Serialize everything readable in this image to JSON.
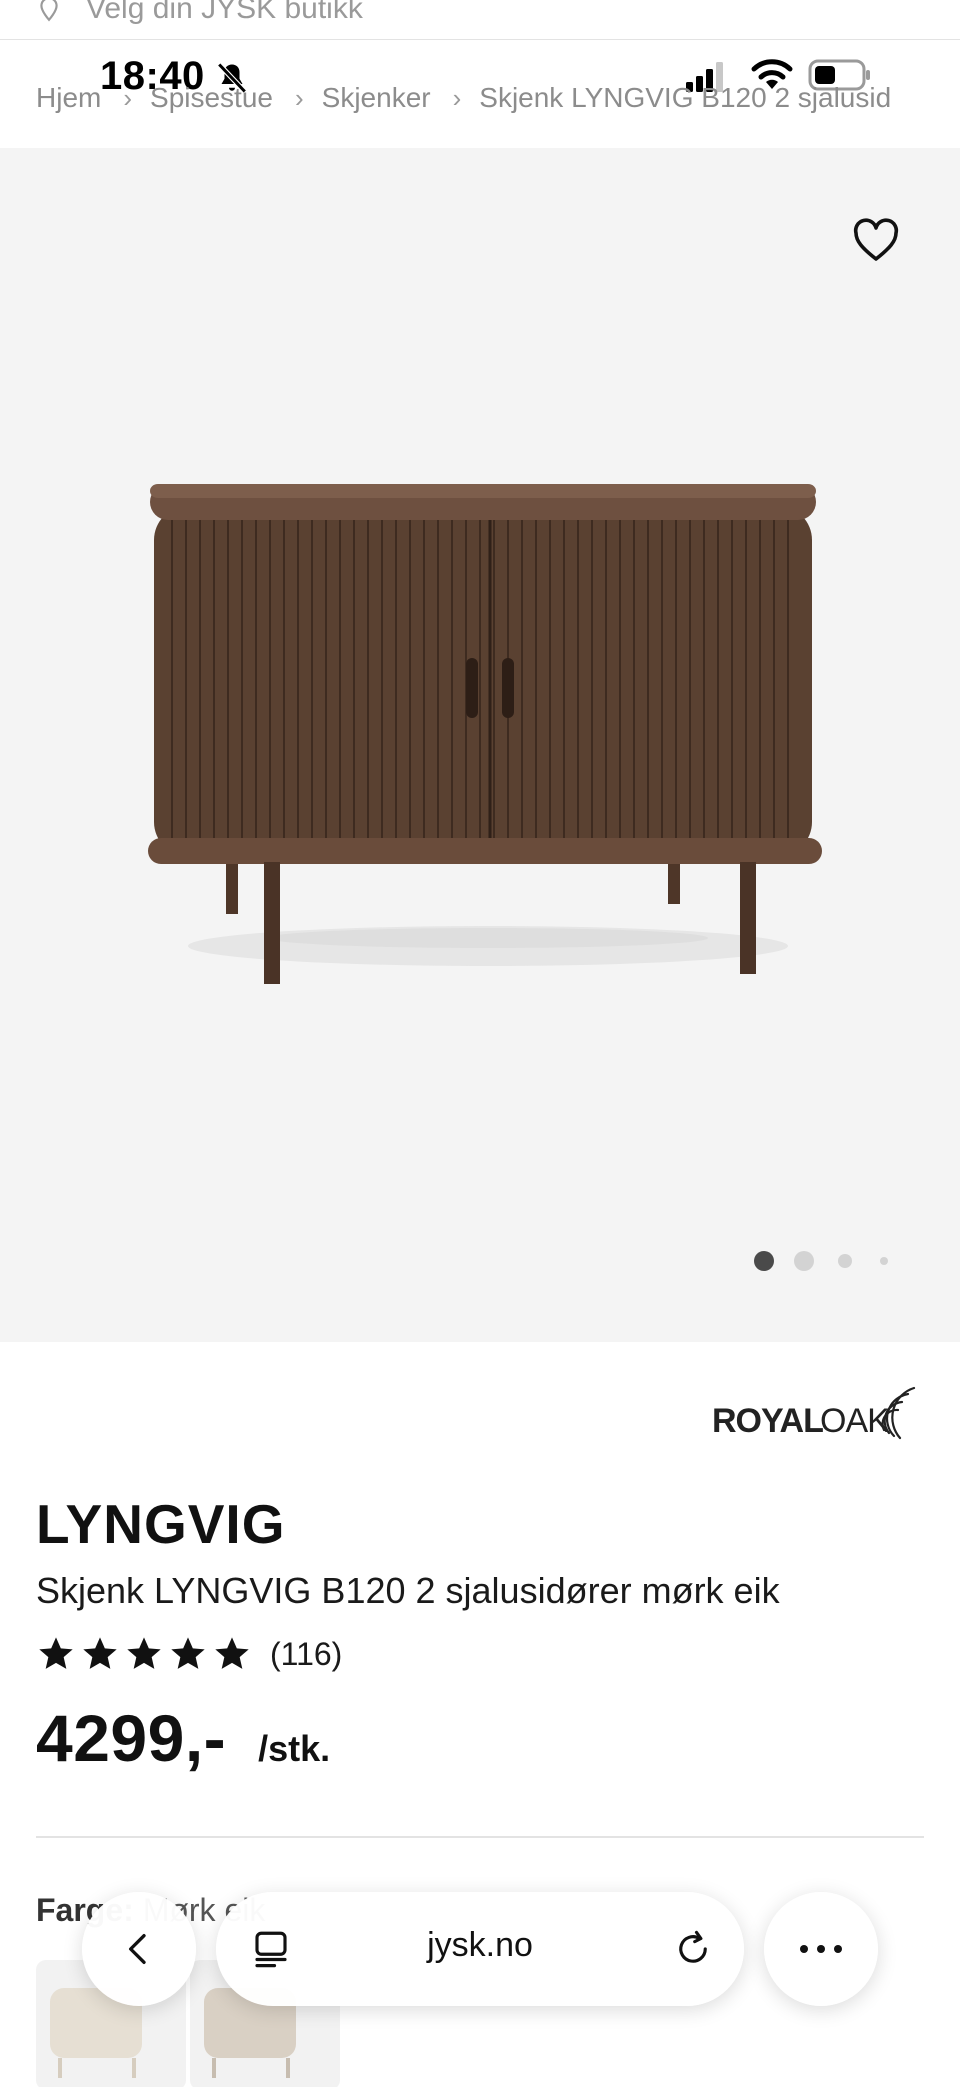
{
  "store": {
    "label": "Velg din JYSK butikk"
  },
  "status_bar": {
    "time": "18:40"
  },
  "breadcrumb": {
    "items": [
      {
        "label": "Hjem"
      },
      {
        "label": "Spisestue"
      },
      {
        "label": "Skjenker"
      },
      {
        "label": "Skjenk LYNGVIG B120 2 sjalusid"
      }
    ]
  },
  "gallery": {
    "image_count": 4,
    "active_index": 0
  },
  "brand": {
    "name": "ROYAL OAK"
  },
  "product": {
    "title": "LYNGVIG",
    "subtitle": "Skjenk LYNGVIG B120 2 sjalusidører mørk eik",
    "rating_stars": 5,
    "review_count": "(116)",
    "price": "4299,-",
    "unit": "/stk."
  },
  "color": {
    "label": "Farge:",
    "value": "Mørk eik"
  },
  "browser": {
    "url": "jysk.no"
  },
  "colors": {
    "hero_bg": "#f4f4f4",
    "wood": "#5a4131",
    "accent": "#111111"
  }
}
